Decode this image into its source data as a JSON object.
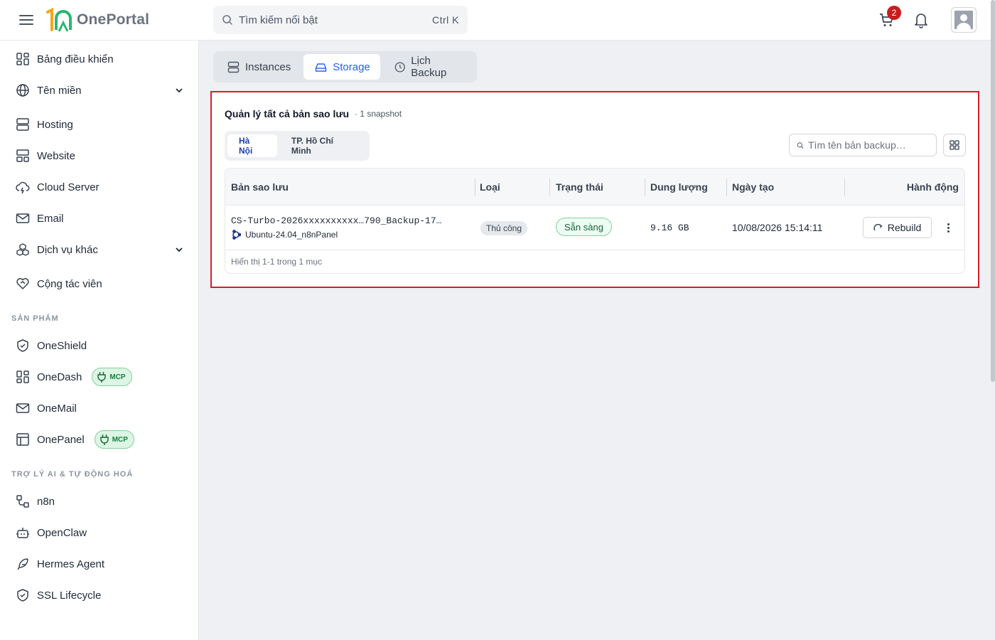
{
  "app": {
    "logo_text": "OnePortal"
  },
  "search": {
    "placeholder": "Tìm kiếm nổi bật",
    "shortcut": "Ctrl K"
  },
  "header": {
    "cart_count": "2"
  },
  "sidebar": {
    "items": [
      {
        "label": "Bảng điều khiển",
        "icon": "dashboard-icon"
      },
      {
        "label": "Tên miền",
        "icon": "globe-icon",
        "expandable": true
      },
      {
        "label": "Hosting",
        "icon": "server-icon"
      },
      {
        "label": "Website",
        "icon": "layout-icon"
      },
      {
        "label": "Cloud Server",
        "icon": "cloud-icon"
      },
      {
        "label": "Email",
        "icon": "mail-icon"
      },
      {
        "label": "Dịch vụ khác",
        "icon": "boxes-icon",
        "expandable": true
      },
      {
        "label": "Cộng tác viên",
        "icon": "heart-handshake-icon"
      }
    ],
    "products_title": "SẢN PHẨM",
    "products": [
      {
        "label": "OneShield",
        "icon": "shield-icon"
      },
      {
        "label": "OneDash",
        "icon": "dashboard-icon",
        "badge": "MCP"
      },
      {
        "label": "OneMail",
        "icon": "mail-icon"
      },
      {
        "label": "OnePanel",
        "icon": "panel-icon",
        "badge": "MCP"
      }
    ],
    "ai_title": "TRỢ LÝ AI & TỰ ĐỘNG HOÁ",
    "ai": [
      {
        "label": "n8n",
        "icon": "workflow-icon"
      },
      {
        "label": "OpenClaw",
        "icon": "bot-icon"
      },
      {
        "label": "Hermes Agent",
        "icon": "feather-icon"
      },
      {
        "label": "SSL Lifecycle",
        "icon": "shield-check-icon"
      }
    ]
  },
  "tabs": [
    {
      "label": "Instances",
      "icon": "server-icon",
      "active": false
    },
    {
      "label": "Storage",
      "icon": "hard-drive-icon",
      "active": true
    },
    {
      "label": "Lịch Backup",
      "icon": "clock-icon",
      "active": false
    }
  ],
  "panel": {
    "title": "Quản lý tất cả bản sao lưu",
    "subtitle": "· 1 snapshot",
    "regions": [
      {
        "label": "Hà Nội",
        "active": true
      },
      {
        "label": "TP. Hồ Chí Minh",
        "active": false
      }
    ],
    "search_placeholder": "Tìm tên bản backup…",
    "table": {
      "columns": [
        "Bản sao lưu",
        "Loại",
        "Trạng thái",
        "Dung lượng",
        "Ngày tạo",
        "Hành động"
      ],
      "rows": [
        {
          "name": "CS-Turbo-2026xxxxxxxxxx…790_Backup-17…",
          "os": "Ubuntu-24.04_n8nPanel",
          "type": "Thủ công",
          "status": "Sẵn sàng",
          "size": "9.16 GB",
          "created": "10/08/2026 15:14:11",
          "action": "Rebuild"
        }
      ],
      "footer": "Hiển thị 1-1 trong 1 mục"
    }
  },
  "colors": {
    "accent": "#2563eb",
    "highlight_border": "#d21f2b",
    "success": "#166534",
    "badge_red": "#c81e1e"
  }
}
